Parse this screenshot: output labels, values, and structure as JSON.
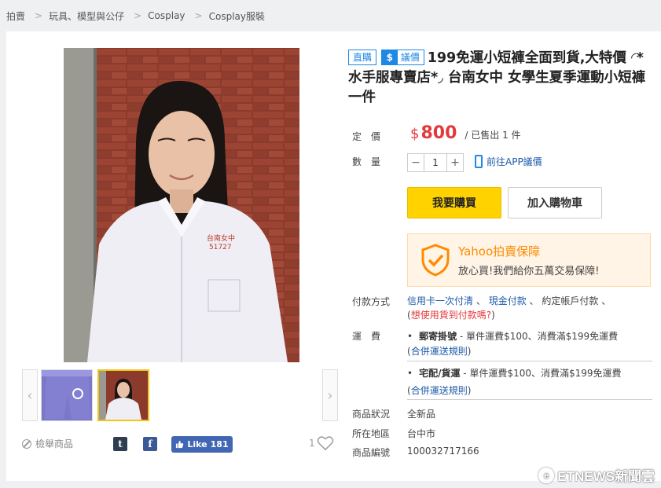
{
  "breadcrumb": [
    "拍賣",
    "玩具、模型與公仔",
    "Cosplay",
    "Cosplay服裝"
  ],
  "photo": {
    "badge_line1": "台南女中",
    "badge_line2": "51727"
  },
  "badges": {
    "direct": "直購",
    "bargain_icon": "$",
    "bargain": "議價"
  },
  "product": {
    "title": "199免運小短褲全面到貨,大特價 ◜*水手服專賣店*◞ 台南女中 女學生夏季運動小短褲一件",
    "price_label": "定　價",
    "currency": "$",
    "price": "800",
    "sold": "/ 已售出 1 件",
    "qty_label": "數　量",
    "qty_minus": "−",
    "qty_value": "1",
    "qty_plus": "+",
    "app_bargain": "前往APP議價"
  },
  "actions": {
    "buy": "我要購買",
    "add_cart": "加入購物車"
  },
  "guarantee": {
    "title": "Yahoo拍賣保障",
    "desc": "放心買!我們給你五萬交易保障!"
  },
  "payment": {
    "label": "付款方式",
    "method1": "信用卡一次付清",
    "sep1": "、",
    "method2": "現金付款",
    "sep2": "、",
    "method3": "約定帳戶付款",
    "sep3": "、",
    "cod_open": "(",
    "cod": "想使用貨到付款嗎?",
    "cod_close": ")"
  },
  "shipping": {
    "label": "運　費",
    "items": [
      {
        "name": "郵寄掛號",
        "detail": " - 單件運費$100、消費滿$199免運費",
        "rule": "合併運送規則"
      },
      {
        "name": "宅配/貨運",
        "detail": " - 單件運費$100、消費滿$199免運費",
        "rule": "合併運送規則"
      }
    ],
    "bullet": "•",
    "rule_open": "(",
    "rule_close": ")"
  },
  "details": {
    "condition_label": "商品狀況",
    "condition": "全新品",
    "location_label": "所在地區",
    "location": "台中市",
    "id_label": "商品編號",
    "id": "100032717166"
  },
  "social": {
    "report": "檢舉商品",
    "tumblr_icon": "t",
    "facebook_icon": "f",
    "like_label": "Like",
    "like_count": "181",
    "fav_count": "1"
  },
  "watermark": {
    "logo": "e",
    "text": "ETNEWS新聞雲"
  },
  "colors": {
    "accent_blue": "#1e88e5",
    "price_red": "#e4393c",
    "buy_yellow": "#ffd200",
    "guarantee_orange": "#ff8a00"
  }
}
